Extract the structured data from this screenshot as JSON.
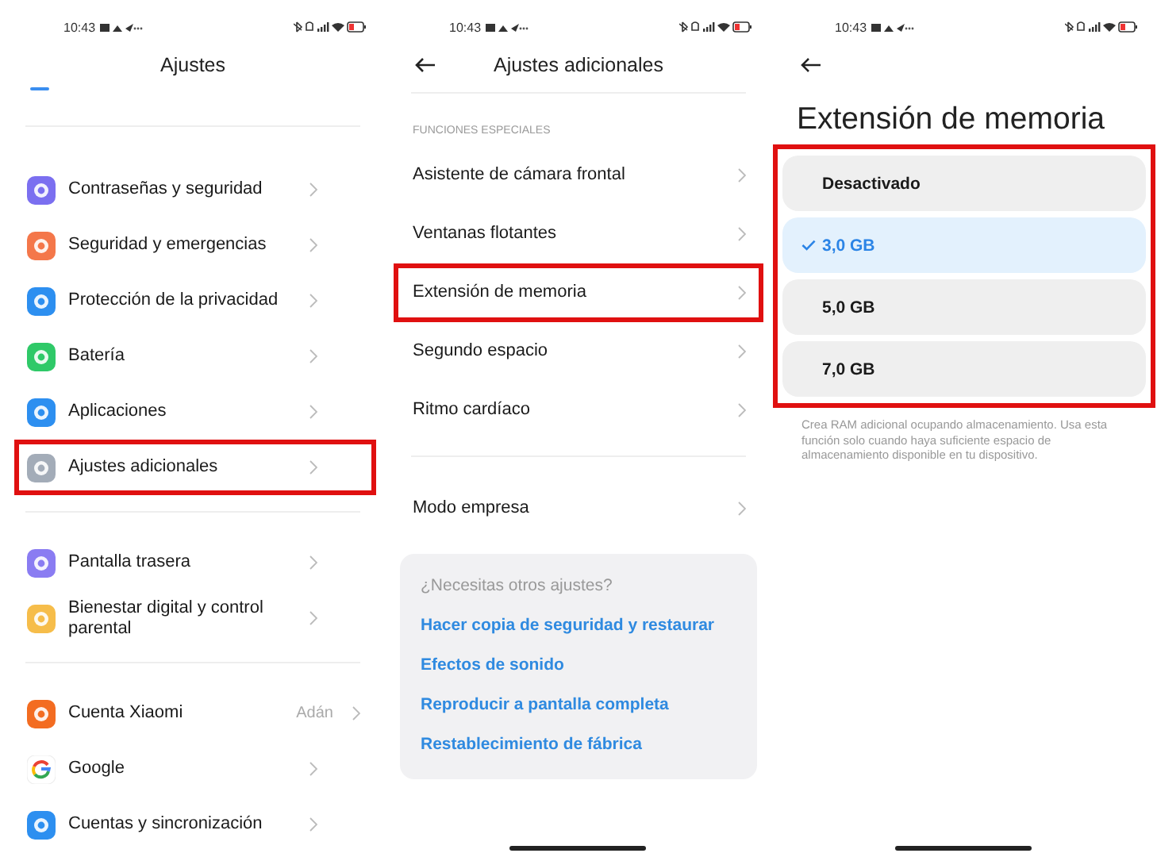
{
  "screens": [
    {
      "status_bar": {
        "time": "10:43"
      },
      "header": {
        "title": "Ajustes",
        "back": false
      },
      "groups": [
        {
          "items": [
            {
              "label": "Contraseñas y seguridad",
              "icon": {
                "kind": "tile",
                "color": "#7b6ff0"
              },
              "highlighted": false
            },
            {
              "label": "Seguridad y emergencias",
              "icon": {
                "kind": "tile",
                "color": "#f4774a"
              },
              "highlighted": false
            },
            {
              "label": "Protección de la privacidad",
              "icon": {
                "kind": "tile",
                "color": "#2d8ff0"
              },
              "highlighted": false
            },
            {
              "label": "Batería",
              "icon": {
                "kind": "tile",
                "color": "#2fc968"
              },
              "highlighted": false
            },
            {
              "label": "Aplicaciones",
              "icon": {
                "kind": "tile",
                "color": "#2d8ff0"
              },
              "highlighted": false
            },
            {
              "label": "Ajustes adicionales",
              "icon": {
                "kind": "tile",
                "color": "#a3acb8"
              },
              "highlighted": true
            }
          ]
        },
        {
          "items": [
            {
              "label": "Pantalla trasera",
              "icon": {
                "kind": "tile",
                "color": "#8a7cf2"
              },
              "highlighted": false
            },
            {
              "label": "Bienestar digital y control parental",
              "icon": {
                "kind": "tile",
                "color": "#f6bd4a"
              },
              "highlighted": false
            }
          ]
        },
        {
          "items": [
            {
              "label": "Cuenta Xiaomi",
              "value": "Adán",
              "icon": {
                "kind": "tile",
                "color": "#f36c21"
              },
              "highlighted": false
            },
            {
              "label": "Google",
              "icon": {
                "kind": "google",
                "color": "#ffffff"
              },
              "highlighted": false
            },
            {
              "label": "Cuentas y sincronización",
              "icon": {
                "kind": "tile",
                "color": "#2d8ff0"
              },
              "highlighted": false
            }
          ]
        }
      ]
    },
    {
      "status_bar": {
        "time": "10:43"
      },
      "header": {
        "title": "Ajustes adicionales",
        "back": true
      },
      "groups": [
        {
          "section": "FUNCIONES ESPECIALES",
          "items": [
            {
              "label": "Asistente de cámara frontal",
              "highlighted": false
            },
            {
              "label": "Ventanas flotantes",
              "highlighted": false
            },
            {
              "label": "Extensión de memoria",
              "highlighted": true
            },
            {
              "label": "Segundo espacio",
              "highlighted": false
            },
            {
              "label": "Ritmo cardíaco",
              "highlighted": false
            }
          ]
        },
        {
          "items": [
            {
              "label": "Modo empresa",
              "highlighted": false
            }
          ]
        }
      ],
      "help_card": {
        "title": "¿Necesitas otros ajustes?",
        "links": [
          "Hacer copia de seguridad y restaurar",
          "Efectos de sonido",
          "Reproducir a pantalla completa",
          "Restablecimiento de fábrica"
        ]
      }
    },
    {
      "status_bar": {
        "time": "10:43"
      },
      "header": {
        "back": true
      },
      "page_title": "Extensión de memoria",
      "options_highlighted": true,
      "options": [
        {
          "label": "Desactivado",
          "selected": false
        },
        {
          "label": "3,0 GB",
          "selected": true
        },
        {
          "label": "5,0 GB",
          "selected": false
        },
        {
          "label": "7,0 GB",
          "selected": false
        }
      ],
      "description": "Crea RAM adicional ocupando almacenamiento. Usa esta función solo cuando haya suficiente espacio de almacenamiento disponible en tu dispositivo."
    }
  ]
}
